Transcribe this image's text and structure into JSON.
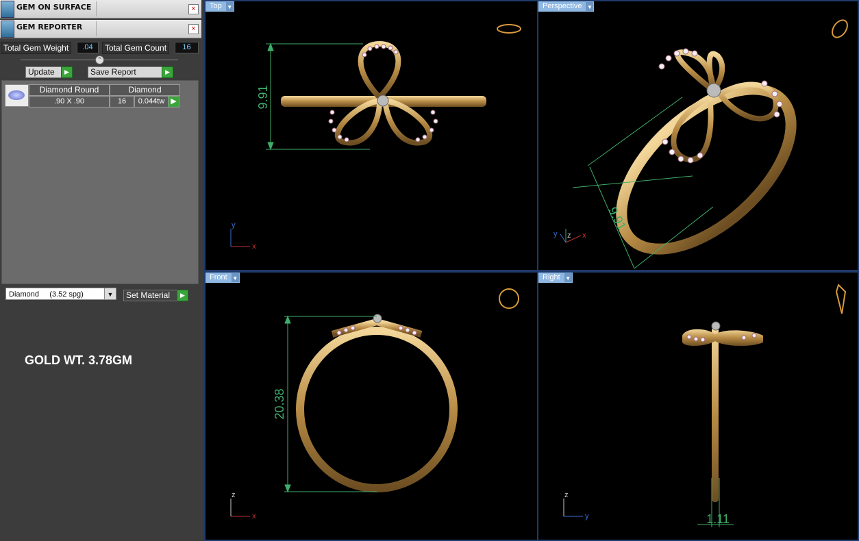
{
  "left_panel": {
    "gem_on_surface": {
      "title": "GEM ON SURFACE",
      "close": "×"
    },
    "gem_reporter": {
      "title": "GEM REPORTER",
      "close": "×"
    },
    "total_gem_weight_label": "Total Gem Weight",
    "total_gem_weight_value": ".04",
    "total_gem_count_label": "Total Gem Count",
    "total_gem_count_value": "16",
    "update_label": "Update",
    "save_report_label": "Save Report",
    "play_glyph": "▶",
    "gem_table": {
      "headers": [
        "Diamond Round",
        "Diamond"
      ],
      "row": {
        "size": ".90 X .90",
        "count": "16",
        "weight": "0.044tw"
      }
    },
    "material_select_value": "Diamond     (3.52 spg)",
    "set_material_label": "Set Material",
    "gold_weight_text": "GOLD WT. 3.78GM"
  },
  "viewports": {
    "top": {
      "tab": "Top",
      "dimension": "9.91",
      "axis_x": "x",
      "axis_y": "y"
    },
    "perspective": {
      "tab": "Perspective",
      "dimension": "9.91",
      "axis_x": "x",
      "axis_y": "y",
      "axis_z": "z"
    },
    "front": {
      "tab": "Front",
      "dimension": "20.38",
      "axis_x": "x",
      "axis_z": "z"
    },
    "right": {
      "tab": "Right",
      "dimension": "1.11",
      "axis_y": "y",
      "axis_z": "z"
    }
  },
  "colors": {
    "accent_blue": "#8fb9e3",
    "gold": "#c9a05a",
    "dimension_green": "#3fae6a",
    "play_green": "#3aa53a"
  }
}
